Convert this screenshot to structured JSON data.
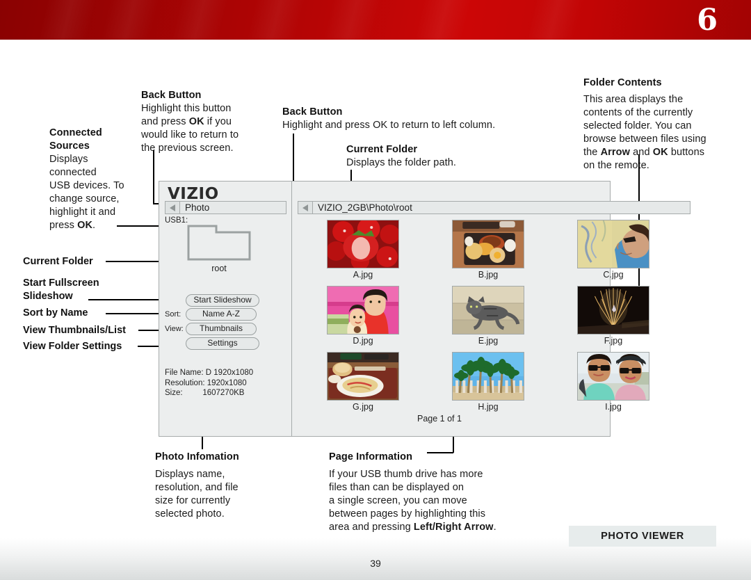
{
  "header": {
    "chapter_number": "6"
  },
  "callouts": {
    "connected_sources": {
      "title": "Connected\nSources",
      "body": "Displays\nconnected\nUSB devices. To\nchange source,\nhighlight it and\npress OK."
    },
    "back_button_left": {
      "title": "Back Button",
      "body": "Highlight this button\nand press OK if you\nwould like to return to\nthe previous screen."
    },
    "back_button_right": {
      "title": "Back Button",
      "body": "Highlight and press OK to return to left column."
    },
    "current_folder_top": {
      "title": "Current Folder",
      "body": "Displays the folder path."
    },
    "folder_contents": {
      "title": "Folder Contents",
      "body": "This area displays the\ncontents of the currently\nselected folder. You can\nbrowse between files using\nthe Arrow and OK buttons\non the remote."
    },
    "photo_information": {
      "title": "Photo Infomation",
      "body": "Displays name,\nresolution, and file\nsize for currently\nselected photo."
    },
    "page_information": {
      "title": "Page Information",
      "body": "If your USB thumb drive has more\nfiles than can be displayed on\na single screen, you can move\nbetween pages by highlighting this\narea and pressing Left/Right Arrow."
    }
  },
  "left_labels": [
    {
      "text": "Current Folder"
    },
    {
      "text": "Start Fullscreen\nSlideshow"
    },
    {
      "text": "Sort by Name"
    },
    {
      "text": "View Thumbnails/List"
    },
    {
      "text": "View Folder Settings"
    }
  ],
  "tv_ui": {
    "brand": "VIZIO",
    "left_pane": {
      "breadcrumb": "Photo",
      "back_icon": "back-triangle-icon",
      "usb_label": "USB1:",
      "folder_icon": "folder-icon",
      "folder_name": "root",
      "buttons": [
        {
          "prefix": "",
          "label": "Start Slideshow",
          "name": "start-slideshow-button"
        },
        {
          "prefix": "Sort:",
          "label": "Name A-Z",
          "name": "sort-button"
        },
        {
          "prefix": "View:",
          "label": "Thumbnails",
          "name": "view-button"
        },
        {
          "prefix": "",
          "label": "Settings",
          "name": "settings-button"
        }
      ],
      "photo_info": "File Name: D 1920x1080\nResolution: 1920x1080\nSize:         1607270KB"
    },
    "right_pane": {
      "breadcrumb": "VIZIO_2GB\\Photo\\root",
      "back_icon": "back-triangle-icon",
      "thumbnails": [
        {
          "name": "A.jpg",
          "subject": "strawberries"
        },
        {
          "name": "B.jpg",
          "subject": "food-tray"
        },
        {
          "name": "C.jpg",
          "subject": "woman-sunglasses-map"
        },
        {
          "name": "D.jpg",
          "subject": "two-girls-pink"
        },
        {
          "name": "E.jpg",
          "subject": "cat"
        },
        {
          "name": "F.jpg",
          "subject": "fiber-optic-lamp"
        },
        {
          "name": "G.jpg",
          "subject": "pasta-plate"
        },
        {
          "name": "H.jpg",
          "subject": "palm-trees"
        },
        {
          "name": "I.jpg",
          "subject": "couple-sunglasses"
        }
      ],
      "page_indicator": "Page 1 of 1"
    }
  },
  "footer": {
    "badge": "PHOTO VIEWER",
    "page_number": "39"
  },
  "colors": {
    "header_red_dark": "#8a0202",
    "header_red_bright": "#cc0606",
    "panel_bg": "#eceeee",
    "panel_border": "#a6abab",
    "badge_bg": "#e7ecec"
  }
}
